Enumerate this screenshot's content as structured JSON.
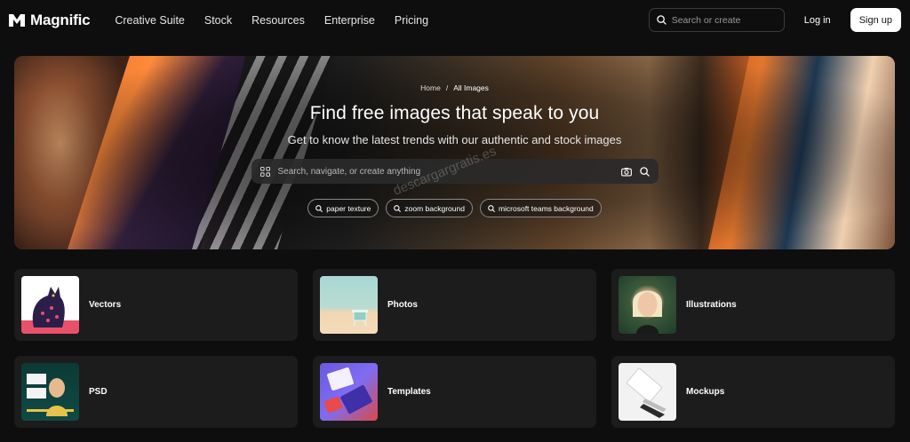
{
  "brand": {
    "name": "Magnific"
  },
  "nav": [
    {
      "label": "Creative Suite"
    },
    {
      "label": "Stock"
    },
    {
      "label": "Resources"
    },
    {
      "label": "Enterprise"
    },
    {
      "label": "Pricing"
    }
  ],
  "header": {
    "search_placeholder": "Search or create",
    "login_label": "Log in",
    "signup_label": "Sign up"
  },
  "hero": {
    "breadcrumb": [
      {
        "label": "Home"
      },
      {
        "label": "All Images"
      }
    ],
    "breadcrumb_separator": "/",
    "title": "Find free images that speak to you",
    "subtitle": "Get to know the latest trends with our authentic and stock images",
    "search_placeholder": "Search, navigate, or create anything",
    "chips": [
      {
        "label": "paper texture"
      },
      {
        "label": "zoom background"
      },
      {
        "label": "microsoft teams background"
      }
    ],
    "watermark": "descargargratis.es"
  },
  "categories": [
    {
      "label": "Vectors",
      "thumb_icon": "leopard-vector-icon"
    },
    {
      "label": "Photos",
      "thumb_icon": "beach-lifeguard-tower-icon"
    },
    {
      "label": "Illustrations",
      "thumb_icon": "woman-portrait-icon"
    },
    {
      "label": "PSD",
      "thumb_icon": "party-flyer-icon"
    },
    {
      "label": "Templates",
      "thumb_icon": "template-cards-icon"
    },
    {
      "label": "Mockups",
      "thumb_icon": "business-card-mockup-icon"
    }
  ],
  "colors": {
    "background": "#0e0e0e",
    "card": "#1c1c1c",
    "signup_bg": "#ffffff"
  }
}
